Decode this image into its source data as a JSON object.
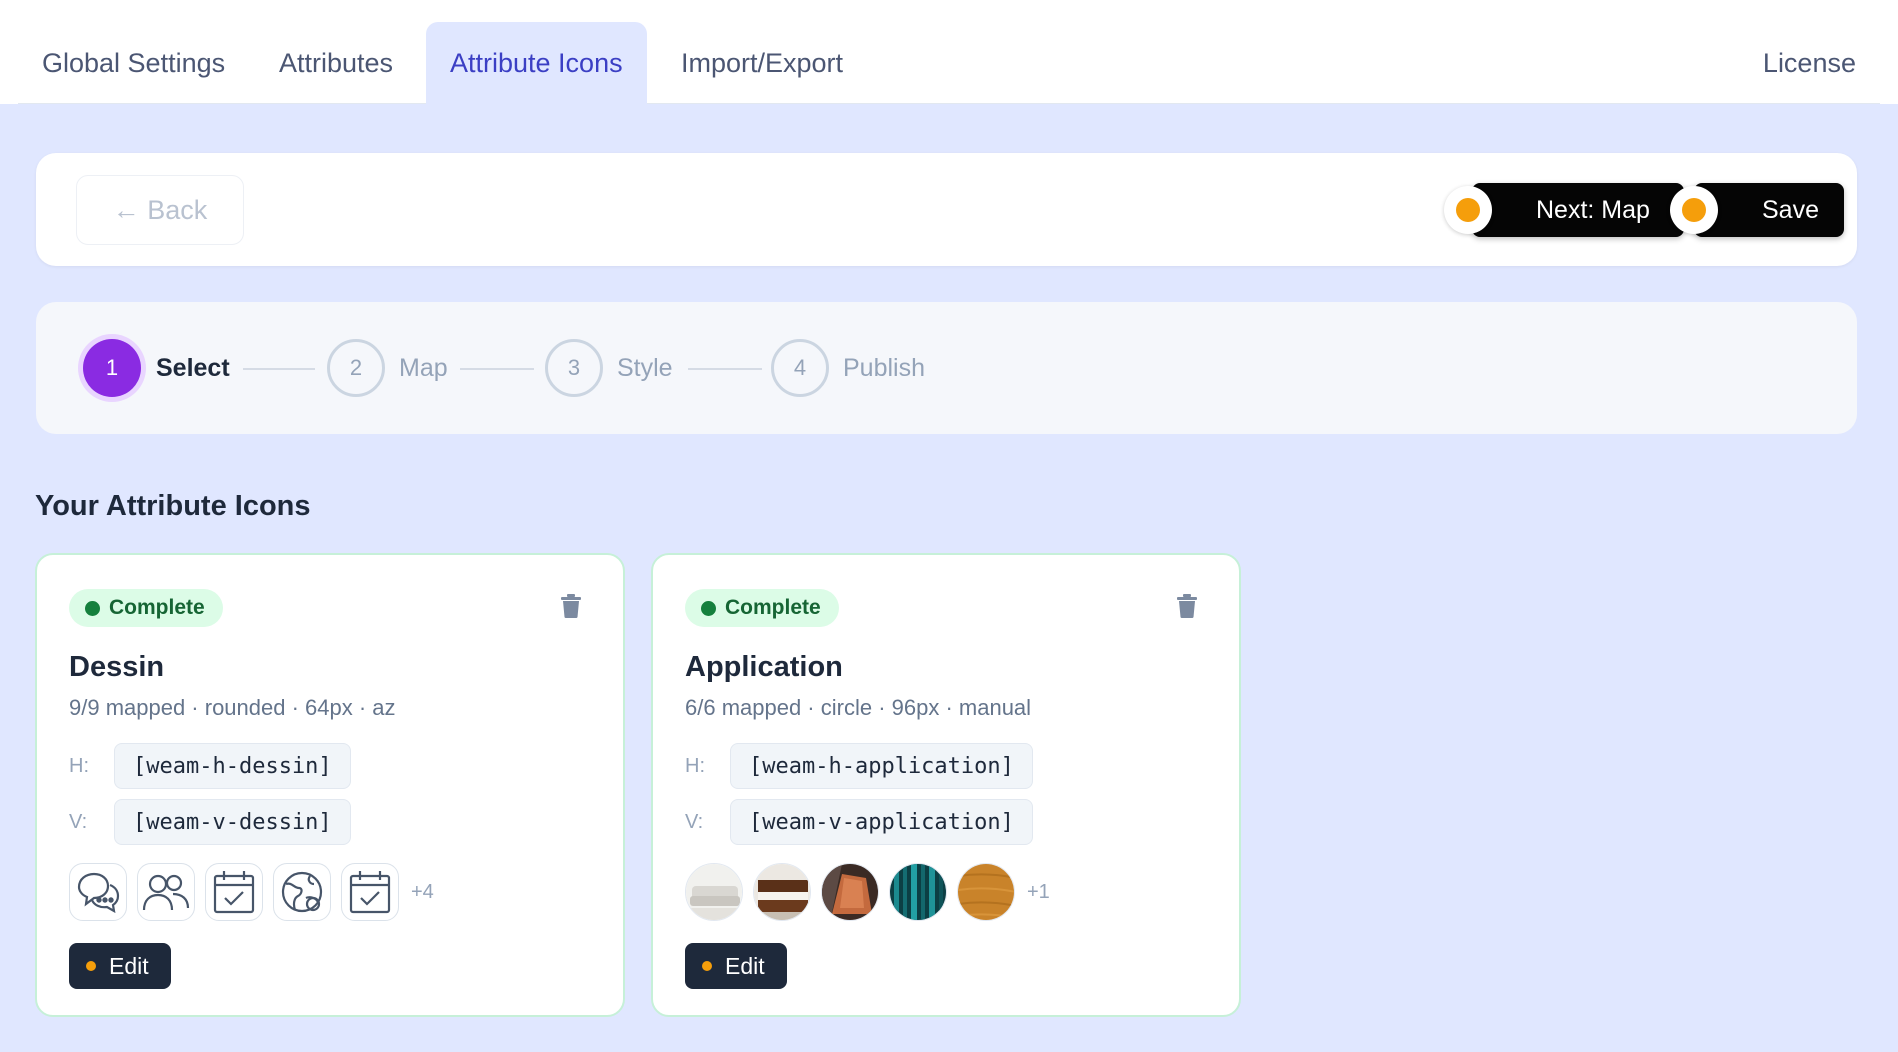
{
  "tabs": [
    {
      "label": "Global Settings",
      "active": false
    },
    {
      "label": "Attributes",
      "active": false
    },
    {
      "label": "Attribute Icons",
      "active": true
    },
    {
      "label": "Import/Export",
      "active": false
    }
  ],
  "license_label": "License",
  "actions": {
    "back_label": "← Back",
    "next_label": "Next: Map",
    "save_label": "Save",
    "indicator_color": "#f59e0b"
  },
  "stepper": {
    "current_step": 1,
    "steps": [
      {
        "number": "1",
        "label": "Select"
      },
      {
        "number": "2",
        "label": "Map"
      },
      {
        "number": "3",
        "label": "Style"
      },
      {
        "number": "4",
        "label": "Publish"
      }
    ]
  },
  "section_title": "Your Attribute Icons",
  "cards": [
    {
      "status": "Complete",
      "title": "Dessin",
      "meta": "9/9 mapped · rounded · 64px · az",
      "h_label": "H:",
      "h_shortcode": "[weam-h-dessin]",
      "v_label": "V:",
      "v_shortcode": "[weam-v-dessin]",
      "thumb_icons": [
        "chat-bubbles-icon",
        "users-icon",
        "calendar-check-icon",
        "globe-icon",
        "calendar-check-icon"
      ],
      "more_count": "+4",
      "edit_label": "Edit"
    },
    {
      "status": "Complete",
      "title": "Application",
      "meta": "6/6 mapped · circle · 96px · manual",
      "h_label": "H:",
      "h_shortcode": "[weam-h-application]",
      "v_label": "V:",
      "v_shortcode": "[weam-v-application]",
      "thumb_images": [
        "sofa-image",
        "bed-image",
        "leather-seat-image",
        "teal-fabric-image",
        "wood-texture-image"
      ],
      "more_count": "+1",
      "edit_label": "Edit"
    }
  ],
  "colors": {
    "accent": "#3b3fc4",
    "step_active": "#8a2be2",
    "complete_badge_bg": "#dcfce7",
    "complete_badge_text": "#166534"
  }
}
